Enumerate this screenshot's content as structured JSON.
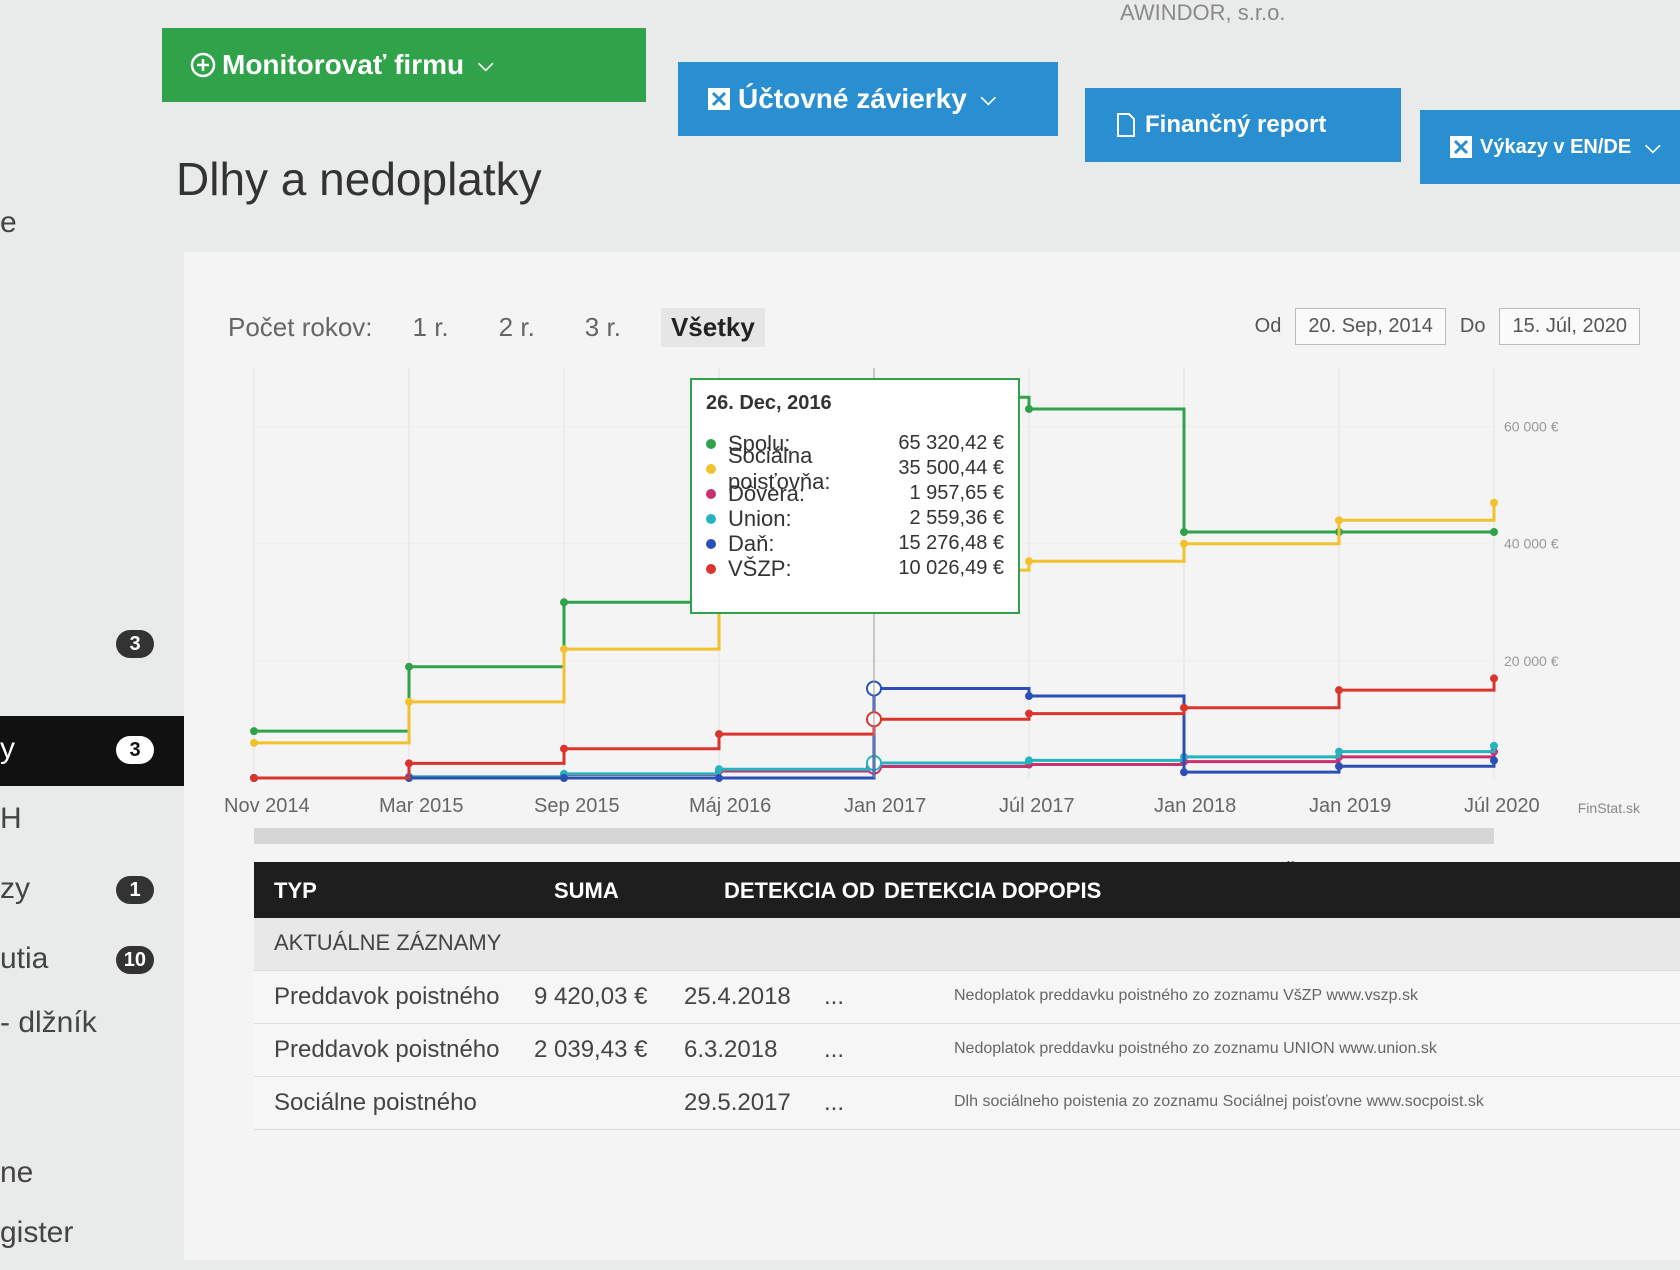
{
  "company": "AWINDOR, s.r.o.",
  "sidebar": {
    "items": [
      {
        "label": "e",
        "badge": ""
      },
      {
        "label": "",
        "badge": "3"
      },
      {
        "label": "y",
        "badge": "3",
        "active": true
      },
      {
        "label": "H",
        "badge": ""
      },
      {
        "label": "zy",
        "badge": "1"
      },
      {
        "label": "utia",
        "badge": "10"
      },
      {
        "label": "- dlžník",
        "badge": ""
      },
      {
        "label": "ne",
        "badge": ""
      },
      {
        "label": "gister",
        "badge": ""
      }
    ]
  },
  "toolbar": {
    "monitor_label": "Monitorovať firmu",
    "statements_label": "Účtovné závierky",
    "report_label": "Finančný report",
    "reports_en_label": "Výkazy v EN/DE"
  },
  "page_title": "Dlhy a nedoplatky",
  "filters": {
    "years_label": "Počet rokov:",
    "years": [
      "1 r.",
      "2 r.",
      "3 r.",
      "Všetky"
    ],
    "active_year": "Všetky",
    "from_label": "Od",
    "from_value": "20. Sep, 2014",
    "to_label": "Do",
    "to_value": "15. Júl, 2020"
  },
  "tooltip": {
    "date": "26. Dec, 2016",
    "rows": [
      {
        "name": "Spolu:",
        "value": "65 320,42 €",
        "color": "#2fa24a"
      },
      {
        "name": "Sociálna poisťovňa:",
        "value": "35 500,44 €",
        "color": "#f2c12e"
      },
      {
        "name": "Dôvera:",
        "value": "1 957,65 €",
        "color": "#c8306e"
      },
      {
        "name": "Union:",
        "value": "2 559,36 €",
        "color": "#22b5c0"
      },
      {
        "name": "Daň:",
        "value": "15 276,48 €",
        "color": "#2c4fb5"
      },
      {
        "name": "VŠZP:",
        "value": "10 026,49 €",
        "color": "#d9352e"
      }
    ]
  },
  "chart_data": {
    "type": "line",
    "x_ticks": [
      "Nov 2014",
      "Mar 2015",
      "Sep 2015",
      "Máj 2016",
      "Jan 2017",
      "Júl 2017",
      "Jan 2018",
      "Jan 2019",
      "Júl 2020"
    ],
    "y_ticks": [
      "20 000 €",
      "40 000 €",
      "60 000 €"
    ],
    "ylim": [
      0,
      70000
    ],
    "x": [
      "2014-11",
      "2015-03",
      "2015-09",
      "2016-05",
      "2016-12",
      "2017-07",
      "2018-01",
      "2019-01",
      "2020-07"
    ],
    "series": [
      {
        "name": "Spolu",
        "color": "#2fa24a",
        "values": [
          8000,
          19000,
          30000,
          45000,
          65000,
          63000,
          42000,
          42000,
          42000
        ]
      },
      {
        "name": "Sociálna poisťovňa",
        "color": "#f2c12e",
        "values": [
          6000,
          13000,
          22000,
          30000,
          35500,
          37000,
          40000,
          44000,
          47000
        ]
      },
      {
        "name": "Dôvera",
        "color": "#c8306e",
        "values": [
          0,
          200,
          600,
          1200,
          1958,
          2300,
          2800,
          3600,
          4500
        ]
      },
      {
        "name": "Union",
        "color": "#22b5c0",
        "values": [
          0,
          200,
          700,
          1500,
          2559,
          3000,
          3600,
          4500,
          5500
        ]
      },
      {
        "name": "Daň",
        "color": "#2c4fb5",
        "values": [
          0,
          0,
          0,
          0,
          15276,
          14000,
          1000,
          2000,
          3000
        ]
      },
      {
        "name": "VŠZP",
        "color": "#d9352e",
        "values": [
          0,
          2500,
          5000,
          7500,
          10026,
          11000,
          12000,
          15000,
          17000
        ]
      }
    ],
    "credit": "FinStat.sk"
  },
  "table": {
    "headers": {
      "typ": "TYP",
      "suma": "SUMA",
      "od": "DETEKCIA OD",
      "do": "DETEKCIA DO",
      "popis": "POPIS"
    },
    "group_label": "AKTUÁLNE ZÁZNAMY",
    "rows": [
      {
        "typ": "Preddavok poistného",
        "suma": "9 420,03 €",
        "od": "25.4.2018",
        "do": "...",
        "popis": "Nedoplatok preddavku poistného zo zoznamu VšZP www.vszp.sk"
      },
      {
        "typ": "Preddavok poistného",
        "suma": "2 039,43 €",
        "od": "6.3.2018",
        "do": "...",
        "popis": "Nedoplatok preddavku poistného zo zoznamu UNION www.union.sk"
      },
      {
        "typ": "Sociálne poistného",
        "suma": "",
        "od": "29.5.2017",
        "do": "...",
        "popis": "Dlh sociálneho poistenia zo zoznamu Sociálnej poisťovne www.socpoist.sk"
      }
    ]
  }
}
